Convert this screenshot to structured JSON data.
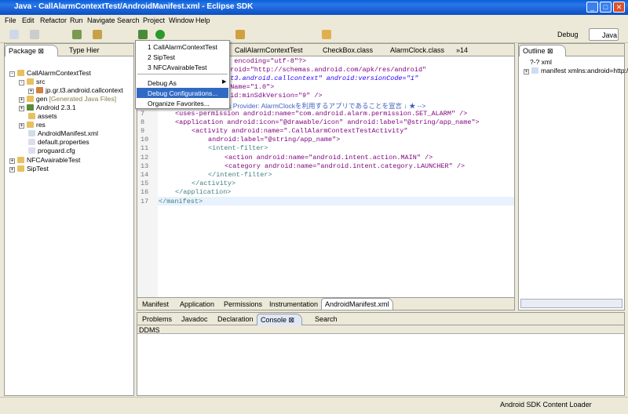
{
  "window": {
    "title": "Java - CallAlarmContextTest/AndroidManifest.xml - Eclipse SDK"
  },
  "menubar": [
    "File",
    "Edit",
    "Refactor",
    "Run",
    "Navigate",
    "Search",
    "Project",
    "Window",
    "Help"
  ],
  "perspectives": {
    "debug": "Debug",
    "java": "Java"
  },
  "package_explorer": {
    "tabs": [
      "Package",
      "Type Hier"
    ],
    "tree": [
      "CallAlarmContextTest",
      "src",
      "jp.gr.t3.android.callcontext",
      "gen",
      "[Generated Java Files]",
      "Android 2.3.1",
      "assets",
      "res",
      "AndroidManifest.xml",
      "default.properties",
      "proguard.cfg",
      "NFCAvairableTest",
      "SipTest"
    ]
  },
  "editor": {
    "tabs": [
      "CallAlarmContextTest",
      "CheckBox.class",
      "AlarmClock.class",
      "»14"
    ],
    "line_numbers": [
      "7",
      "8",
      "9",
      "10",
      "11",
      "12",
      "13",
      "14",
      "15",
      "16",
      "17"
    ],
    "lines": [
      "0\" encoding=\"utf-8\"?>",
      "ndroid=\"http://schemas.android.com/apk/res/android\"",
      "r.t3.android.callcontext\" android:versionCode=\"1\"",
      "onName=\"1.0\">",
      "roid:minSdkVersion=\"9\" />",
      "nts Provider: AlarmClockを利用するアプリであることを宣言 ↓ ★ -->",
      "<uses-permission android:name=\"com.android.alarm.permission.SET_ALARM\" />",
      "<application android:icon=\"@drawable/icon\" android:label=\"@string/app_name\">",
      "<activity android:name=\".CallAlarmContextTestActivity\"",
      "android:label=\"@string/app_name\">",
      "<intent-filter>",
      "<action android:name=\"android.intent.action.MAIN\" />",
      "<category android:name=\"android.intent.category.LAUNCHER\" />",
      "</intent-filter>",
      "</activity>",
      "</application>",
      "</manifest>"
    ],
    "bottom_tabs": [
      "Manifest",
      "Application",
      "Permissions",
      "Instrumentation",
      "AndroidManifest.xml"
    ]
  },
  "outline": {
    "title": "Outline",
    "items": [
      "?-? xml",
      "manifest xmlns:android=http://"
    ]
  },
  "console": {
    "tabs": [
      "Problems",
      "Javadoc",
      "Declaration",
      "Console",
      "Search"
    ],
    "header": "DDMS"
  },
  "debug_menu": {
    "items": [
      "1 CallAlarmContextTest",
      "2 SipTest",
      "3 NFCAvairableTest",
      "Debug As",
      "Debug Configurations...",
      "Organize Favorites..."
    ]
  },
  "status": {
    "text": "Android SDK Content Loader"
  }
}
